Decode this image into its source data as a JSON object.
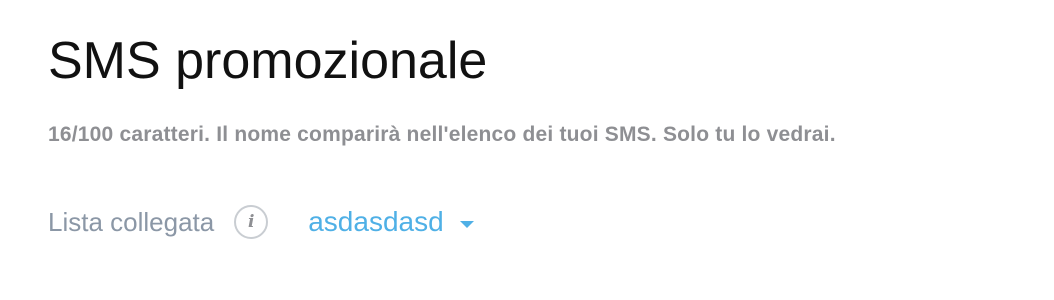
{
  "campaign": {
    "name": "SMS promozionale",
    "helper": "16/100 caratteri. Il nome comparirà nell'elenco dei tuoi SMS. Solo tu lo vedrai."
  },
  "linked_list": {
    "label": "Lista collegata",
    "info_glyph": "i",
    "selected": "asdasdasd"
  },
  "icons": [
    "info-icon",
    "caret-down-icon"
  ],
  "colors": {
    "title": "#111111",
    "helper": "#8e8f93",
    "label": "#8b97a6",
    "accent": "#4fb0e6"
  }
}
